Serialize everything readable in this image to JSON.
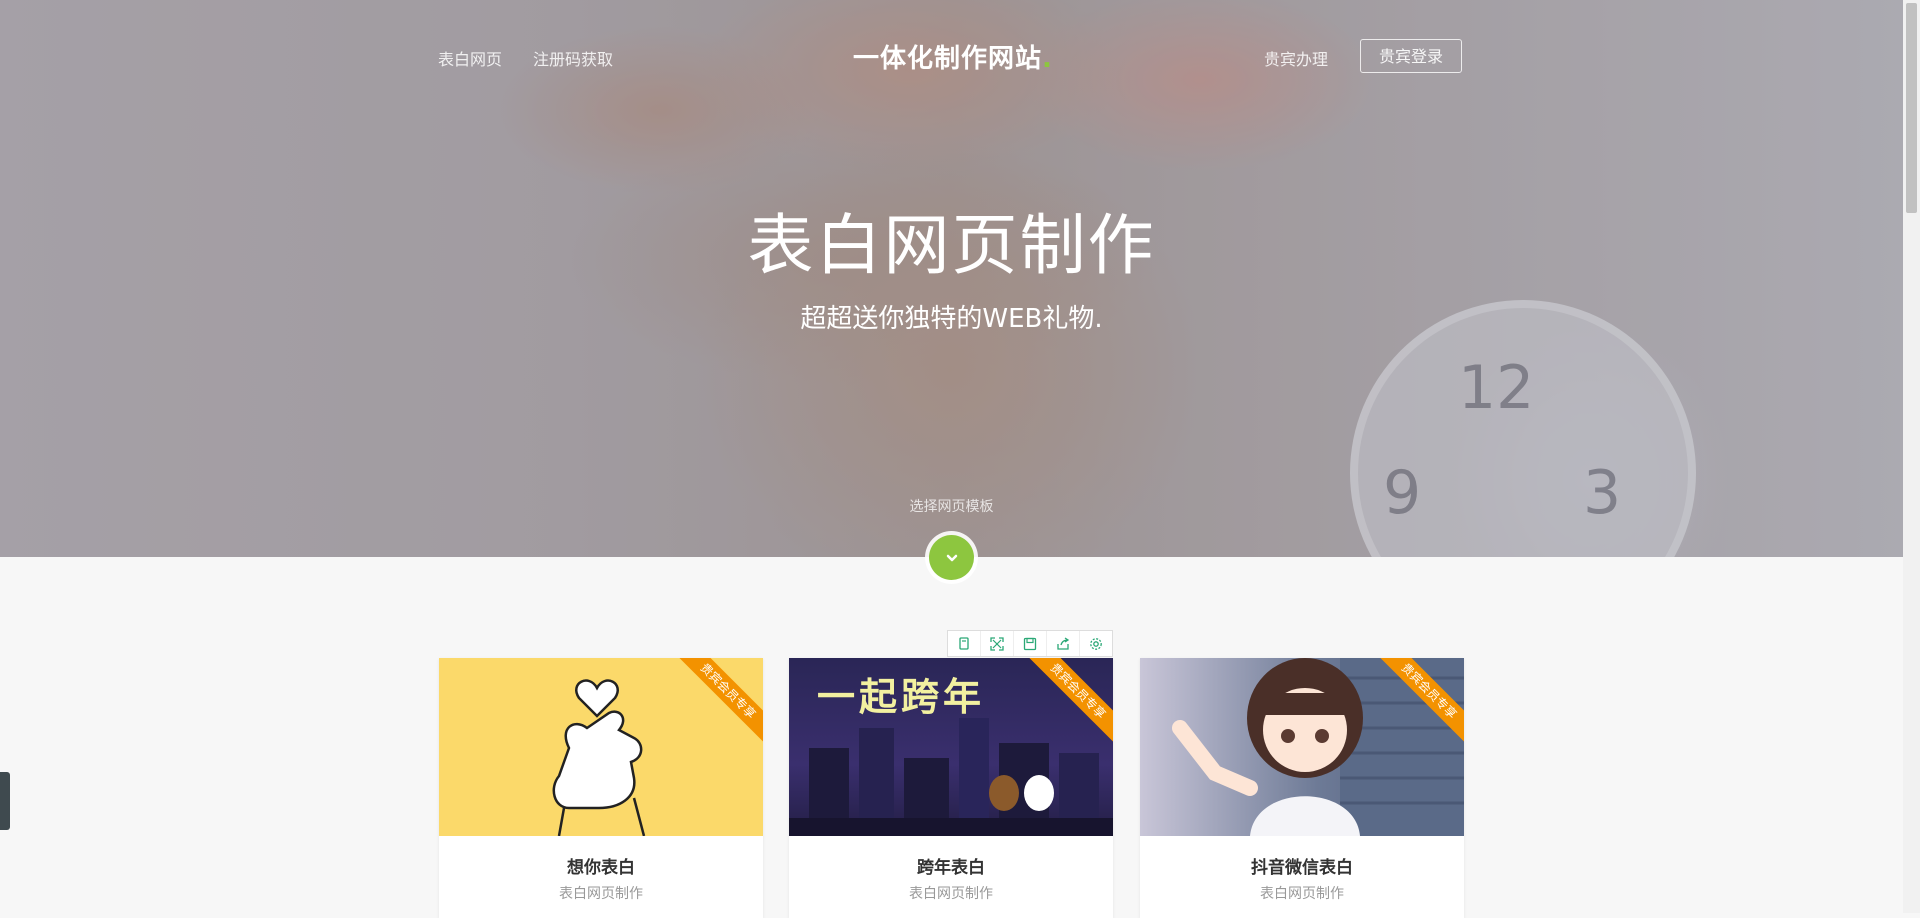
{
  "nav": {
    "left_links": [
      "表白网页",
      "注册码获取"
    ],
    "brand": "一体化制作网站",
    "brand_dot": ".",
    "vip_link": "贵宾办理",
    "login_button": "贵宾登录"
  },
  "hero": {
    "title": "表白网页制作",
    "subtitle": "超超送你独特的WEB礼物.",
    "choose_text": "选择网页模板",
    "clock_numbers": [
      "12",
      "9",
      "3"
    ]
  },
  "toolbar": {
    "icons": [
      "copy-icon",
      "expand-icon",
      "save-icon",
      "share-icon",
      "settings-icon"
    ]
  },
  "cards": [
    {
      "title": "想你表白",
      "subtitle": "表白网页制作",
      "ribbon": "贵宾会员专享",
      "image": "finger-heart-illustration"
    },
    {
      "title": "跨年表白",
      "subtitle": "表白网页制作",
      "ribbon": "贵宾会员专享",
      "image": "new-year-city-night-illustration",
      "image_text": "一起跨年"
    },
    {
      "title": "抖音微信表白",
      "subtitle": "表白网页制作",
      "ribbon": "贵宾会员专享",
      "image": "anime-girl-pointing-illustration"
    }
  ],
  "colors": {
    "accent": "#8dc63f",
    "ribbon": "#f39200",
    "card1_bg": "#fbd96a",
    "card2_bg": "#2e2a5a"
  }
}
